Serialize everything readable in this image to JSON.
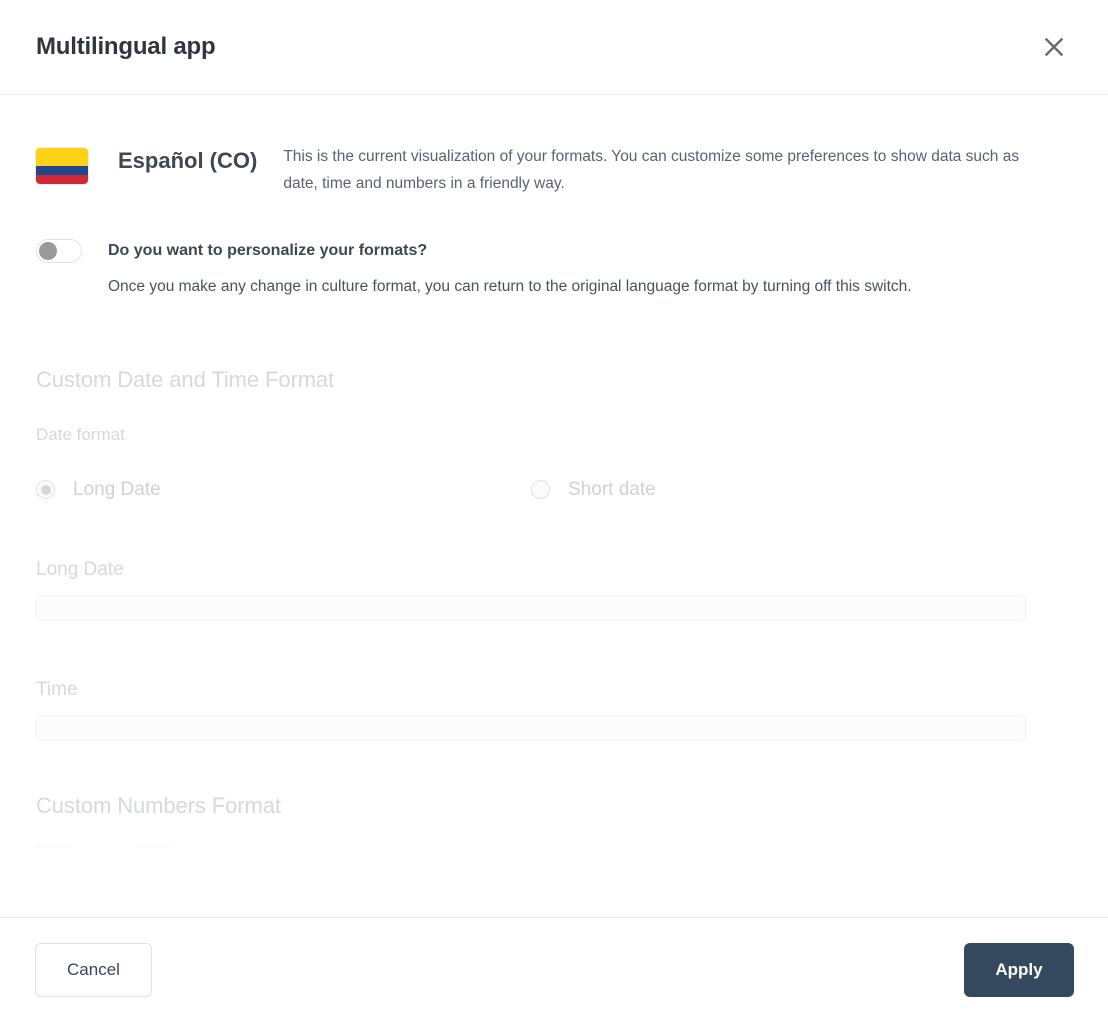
{
  "header": {
    "title": "Multilingual app",
    "close_icon": "close-icon"
  },
  "language": {
    "flag_icon": "flag-colombia-icon",
    "name": "Español (CO)",
    "description": "This is the current visualization of your formats. You can customize some preferences to show data such as date, time and numbers in a friendly way."
  },
  "personalize": {
    "toggle_state": "off",
    "label": "Do you want to personalize your formats?",
    "description": "Once you make any change in culture format, you can return to the original language format by turning off this switch."
  },
  "date_time_section": {
    "title": "Custom Date and Time Format",
    "date_format_label": "Date format",
    "options": [
      {
        "label": "Long Date",
        "selected": true
      },
      {
        "label": "Short date",
        "selected": false
      }
    ],
    "long_date_label": "Long Date",
    "long_date_value": "",
    "long_date_placeholder": "",
    "time_label": "Time",
    "time_value": "",
    "time_placeholder": ""
  },
  "numbers_section": {
    "title": "Custom Numbers Format"
  },
  "footer": {
    "cancel_label": "Cancel",
    "apply_label": "Apply"
  },
  "colors": {
    "apply_button": "#34495e",
    "flag_yellow": "#FCD116",
    "flag_blue": "#21468B",
    "flag_red": "#CE2B37",
    "title_text": "#2f3640",
    "disabled_text": "#d6d8dc"
  }
}
